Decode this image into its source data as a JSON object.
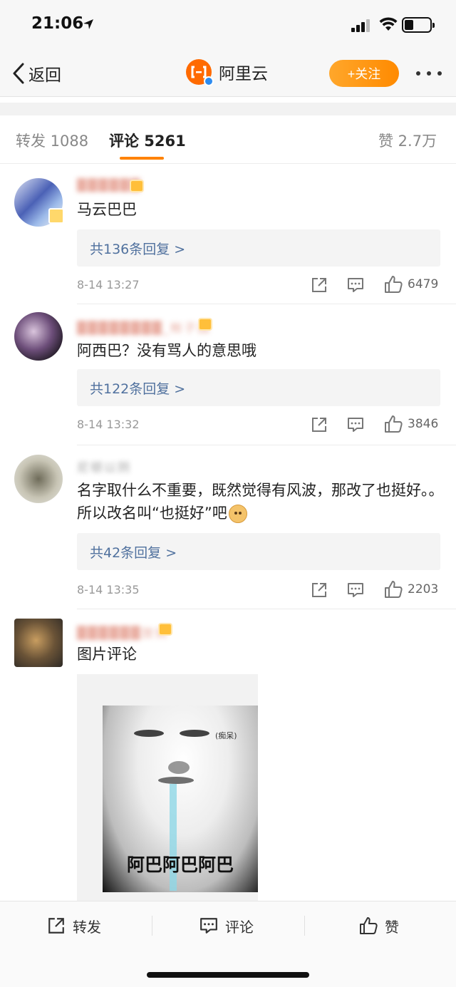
{
  "status_bar": {
    "time": "21:06"
  },
  "nav": {
    "back_label": "返回",
    "title": "阿里云",
    "follow_label": "+关注"
  },
  "tabs": [
    {
      "label": "转发 1088"
    },
    {
      "label": "评论 5261"
    },
    {
      "label": "赞 2.7万"
    }
  ],
  "comments": [
    {
      "username": "██████",
      "text": "马云巴巴",
      "reply_label": "共136条回复 >",
      "time": "8-14 13:27",
      "likes": "6479"
    },
    {
      "username": "████████_帐子国",
      "text": "阿西巴？没有骂人的意思哦",
      "reply_label": "共122条回复 >",
      "time": "8-14 13:32",
      "likes": "3846"
    },
    {
      "username": "尼顿以阴",
      "text": "名字取什么不重要，既然觉得有风波，那改了也挺好。。所以改名叫“也挺好”吧",
      "reply_label": "共42条回复 >",
      "time": "8-14 13:35",
      "likes": "2203"
    },
    {
      "username": "██████放倘",
      "text": "图片评论",
      "image_caption": "阿巴阿巴阿巴",
      "image_small_text": "(痴呆)"
    }
  ],
  "bottom_bar": {
    "repost_label": "转发",
    "comment_label": "评论",
    "like_label": "赞"
  },
  "colors": {
    "accent_orange": "#ff8200",
    "link_blue": "#50719e",
    "follow_gradient_start": "#ffa72b",
    "follow_gradient_end": "#ff8a00"
  }
}
